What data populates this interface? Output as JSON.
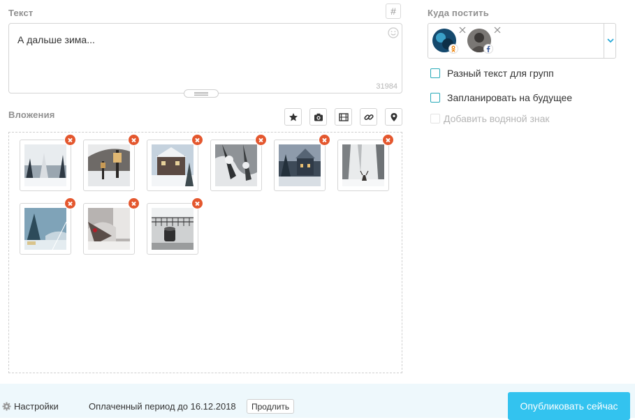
{
  "text_section": {
    "label": "Текст",
    "hashtag_icon": "hash-icon",
    "hashtag_symbol": "#",
    "value": "А дальше зима...",
    "char_count": "31984",
    "emoji_icon": "smile-icon"
  },
  "attachments": {
    "label": "Вложения",
    "buttons": [
      {
        "icon": "star-icon"
      },
      {
        "icon": "camera-icon"
      },
      {
        "icon": "film-icon"
      },
      {
        "icon": "link-icon"
      },
      {
        "icon": "location-pin-icon"
      }
    ],
    "images_count": 9
  },
  "destination": {
    "label": "Куда постить",
    "accounts": [
      {
        "icon": "avatar",
        "badge": "odnoklassniki-icon"
      },
      {
        "icon": "avatar",
        "badge": "facebook-icon"
      }
    ],
    "dropdown_icon": "chevron-down-icon"
  },
  "options": {
    "different_text": "Разный текст для групп",
    "schedule": "Запланировать на будущее",
    "watermark": "Добавить водяной знак"
  },
  "footer": {
    "settings": "Настройки",
    "period": "Оплаченный период до 16.12.2018",
    "extend": "Продлить",
    "publish": "Опубликовать сейчас"
  },
  "colors": {
    "accent": "#33c3ef",
    "remove": "#e4572e",
    "checkbox": "#27a9b8",
    "footer_bg": "#eef8fc"
  }
}
